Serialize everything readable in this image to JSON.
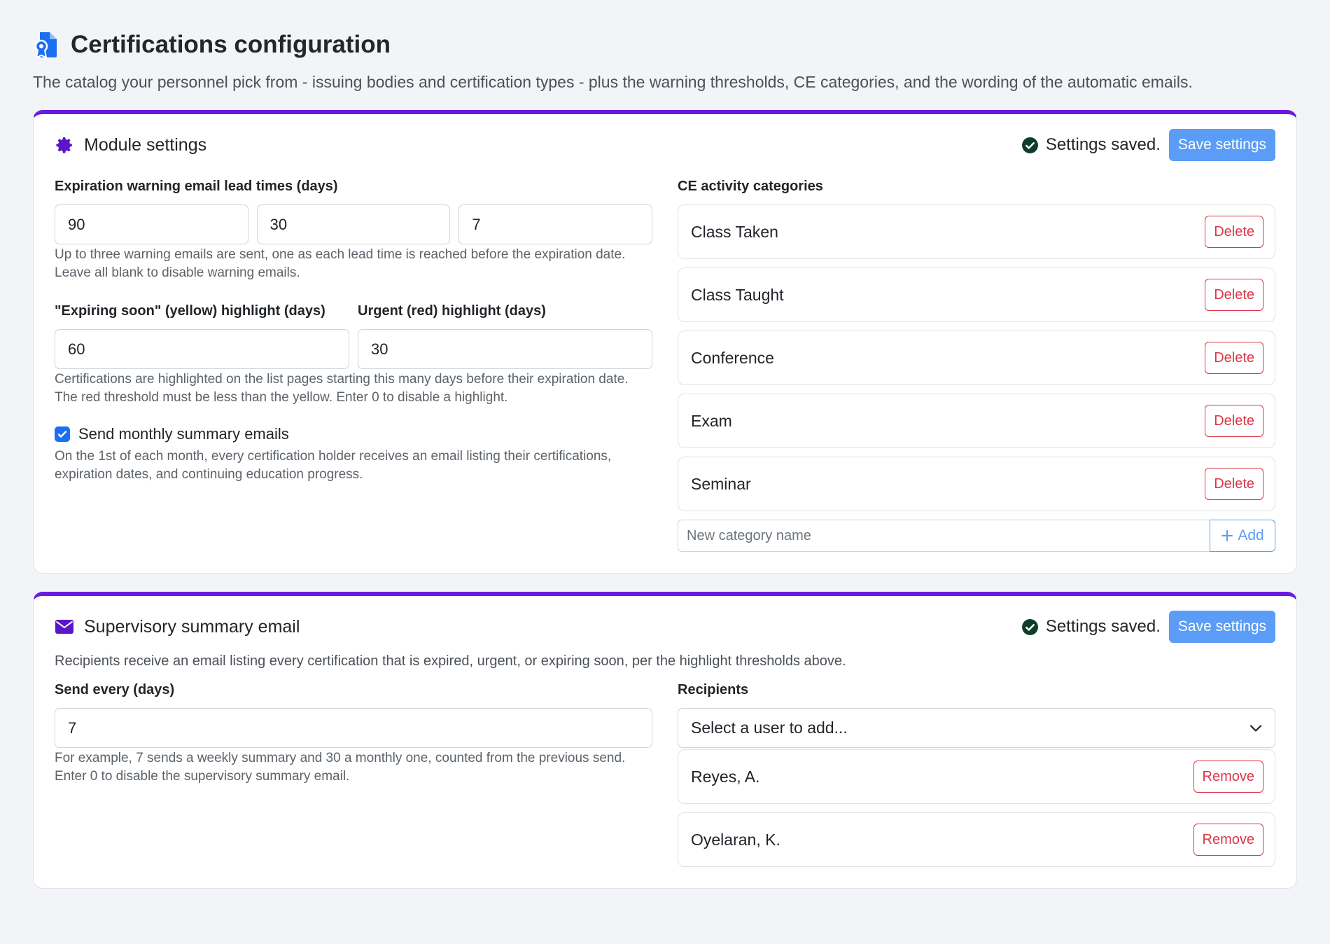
{
  "page": {
    "title": "Certifications configuration",
    "subtitle": "The catalog your personnel pick from - issuing bodies and certification types - plus the warning thresholds, CE categories, and the wording of the automatic emails."
  },
  "colors": {
    "accent": "#6a1be0",
    "primary": "#5b9df6",
    "danger": "#dc3545",
    "success": "#0f3d2a"
  },
  "module_settings": {
    "title": "Module settings",
    "icon": "gear-icon",
    "saved_text": "Settings saved.",
    "save_label": "Save settings",
    "lead_times": {
      "label": "Expiration warning email lead times (days)",
      "values": [
        "90",
        "30",
        "7"
      ],
      "help": "Up to three warning emails are sent, one as each lead time is reached before the expiration date. Leave all blank to disable warning emails."
    },
    "yellow": {
      "label": "\"Expiring soon\" (yellow) highlight (days)",
      "value": "60"
    },
    "red": {
      "label": "Urgent (red) highlight (days)",
      "value": "30"
    },
    "highlight_help": "Certifications are highlighted on the list pages starting this many days before their expiration date. The red threshold must be less than the yellow. Enter 0 to disable a highlight.",
    "monthly": {
      "label": "Send monthly summary emails",
      "checked": true,
      "help": "On the 1st of each month, every certification holder receives an email listing their certifications, expiration dates, and continuing education progress."
    },
    "ce_categories": {
      "label": "CE activity categories",
      "items": [
        {
          "name": "Class Taken",
          "action": "Delete"
        },
        {
          "name": "Class Taught",
          "action": "Delete"
        },
        {
          "name": "Conference",
          "action": "Delete"
        },
        {
          "name": "Exam",
          "action": "Delete"
        },
        {
          "name": "Seminar",
          "action": "Delete"
        }
      ],
      "new_placeholder": "New category name",
      "add_label": "Add"
    }
  },
  "supervisory": {
    "title": "Supervisory summary email",
    "icon": "envelope-icon",
    "saved_text": "Settings saved.",
    "save_label": "Save settings",
    "intro": "Recipients receive an email listing every certification that is expired, urgent, or expiring soon, per the highlight thresholds above.",
    "send_every": {
      "label": "Send every (days)",
      "value": "7",
      "help": "For example, 7 sends a weekly summary and 30 a monthly one, counted from the previous send. Enter 0 to disable the supervisory summary email."
    },
    "recipients": {
      "label": "Recipients",
      "select_placeholder": "Select a user to add...",
      "items": [
        {
          "name": "Reyes, A.",
          "action": "Remove"
        },
        {
          "name": "Oyelaran, K.",
          "action": "Remove"
        }
      ]
    }
  }
}
